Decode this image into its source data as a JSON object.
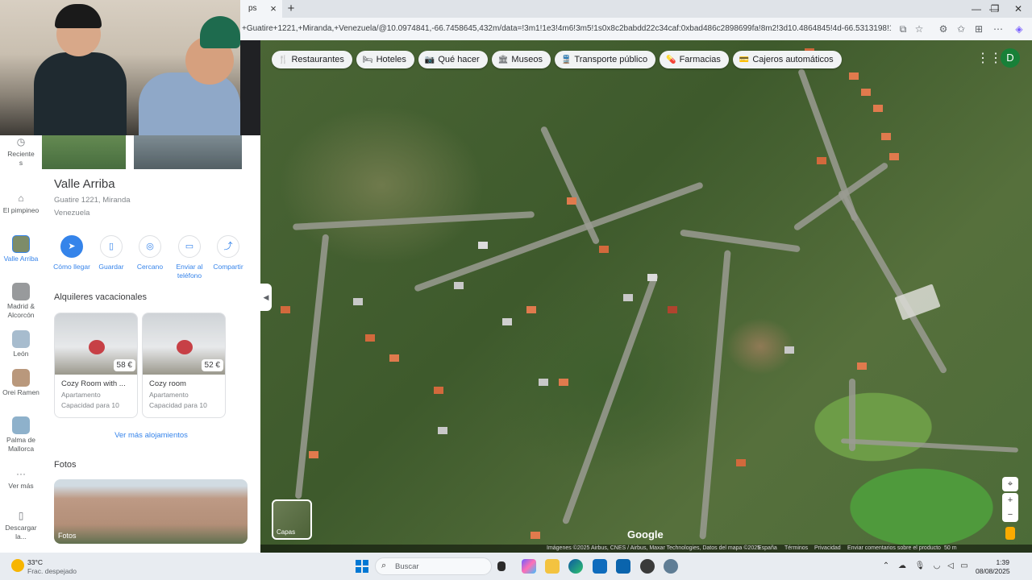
{
  "browser": {
    "tab_close": "×",
    "new_tab": "+",
    "url": "+Guatire+1221,+Miranda,+Venezuela/@10.0974841,-66.7458645,432m/data=!3m1!1e3!4m6!3m5!1s0x8c2babdd22c34caf:0xbad486c2898699fa!8m2!3d10.4864845!4d-66.5313198!16s%2Fg%2F1...",
    "window_controls": [
      "—",
      "❐",
      "✕"
    ]
  },
  "map": {
    "chips": [
      {
        "label": "Restaurantes",
        "icon": "🍴"
      },
      {
        "label": "Hoteles",
        "icon": "🛏"
      },
      {
        "label": "Qué hacer",
        "icon": "📷"
      },
      {
        "label": "Museos",
        "icon": "🏛"
      },
      {
        "label": "Transporte público",
        "icon": "🚆"
      },
      {
        "label": "Farmacias",
        "icon": "💊"
      },
      {
        "label": "Cajeros automáticos",
        "icon": "💳"
      }
    ],
    "avatar_initial": "D",
    "layers_label": "Capas",
    "google_logo": "Google",
    "footer": {
      "imagery": "Imágenes ©2025 Airbus, CNES / Airbus, Maxar Technologies, Datos del mapa ©2025",
      "country": "España",
      "terms": "Términos",
      "privacy": "Privacidad",
      "feedback": "Enviar comentarios sobre el producto",
      "scale": "50 m"
    }
  },
  "rail": {
    "items": [
      {
        "label": "Reciente\ns"
      },
      {
        "label": "El pimpineo"
      },
      {
        "label": "Valle Arriba"
      },
      {
        "label": "Madrid & Alcorcón"
      },
      {
        "label": "León"
      },
      {
        "label": "Orei Ramen"
      },
      {
        "label": "Palma de Mallorca"
      },
      {
        "label": "Ver más"
      },
      {
        "label": "Descargar la..."
      }
    ]
  },
  "place": {
    "title": "Valle Arriba",
    "address": "Guatire 1221, Miranda",
    "country": "Venezuela",
    "actions": [
      {
        "label": "Cómo llegar",
        "icon": "➤"
      },
      {
        "label": "Guardar",
        "icon": "▯"
      },
      {
        "label": "Cercano",
        "icon": "◎"
      },
      {
        "label": "Enviar al teléfono",
        "icon": "▭"
      },
      {
        "label": "Compartir",
        "icon": "⤴"
      }
    ]
  },
  "rentals": {
    "title": "Alquileres vacacionales",
    "items": [
      {
        "name": "Cozy Room with ...",
        "price": "58 €",
        "type": "Apartamento",
        "capacity": "Capacidad para 10"
      },
      {
        "name": "Cozy room",
        "price": "52 €",
        "type": "Apartamento",
        "capacity": "Capacidad para 10"
      }
    ],
    "see_more": "Ver más alojamientos"
  },
  "photos": {
    "title": "Fotos",
    "label": "Fotos"
  },
  "taskbar": {
    "weather_temp": "33°C",
    "weather_cond": "Frac. despejado",
    "search_placeholder": "Buscar",
    "time": "1:39",
    "date": "08/08/2025"
  }
}
